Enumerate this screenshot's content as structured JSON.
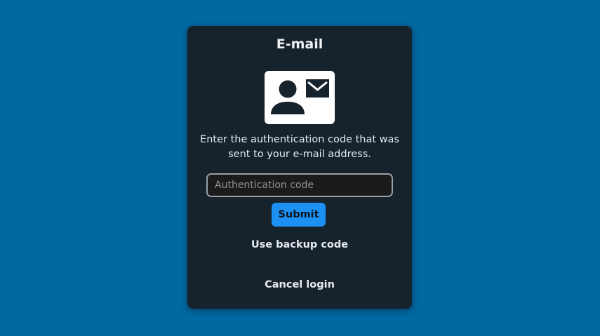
{
  "dialog": {
    "title": "E-mail",
    "illustration_icon": "contact-card-email-icon",
    "message": "Enter the authentication code that was sent to your e-mail address.",
    "code_input": {
      "value": "",
      "placeholder": "Authentication code"
    },
    "submit_label": "Submit",
    "backup_code_label": "Use backup code",
    "cancel_label": "Cancel login"
  },
  "colors": {
    "background": "#0069a2",
    "card": "#16222c",
    "accent": "#1c90f3"
  }
}
